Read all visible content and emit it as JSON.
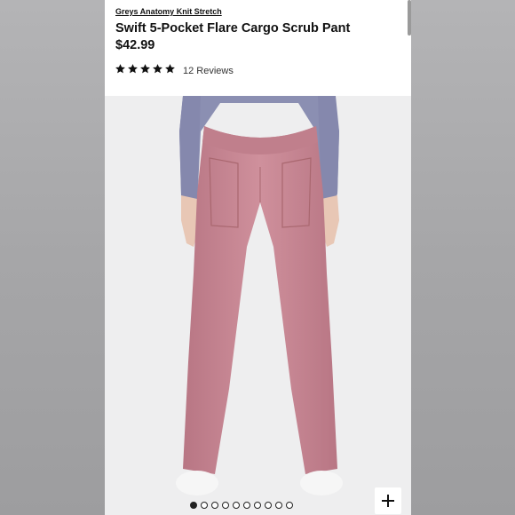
{
  "product": {
    "brand_link": "Greys Anatomy Knit Stretch",
    "title": "Swift 5-Pocket Flare Cargo Scrub Pant",
    "price": "$42.99",
    "rating": 5,
    "rating_max": 5,
    "reviews_label": "12 Reviews"
  },
  "colors": {
    "pant": "#c78793",
    "shirt": "#8b8fb2",
    "background": "#eeeeef",
    "text": "#111111"
  },
  "gallery": {
    "total_images": 10,
    "active_index": 0
  },
  "icons": {
    "zoom": "plus-icon",
    "rating": "star-icon"
  }
}
